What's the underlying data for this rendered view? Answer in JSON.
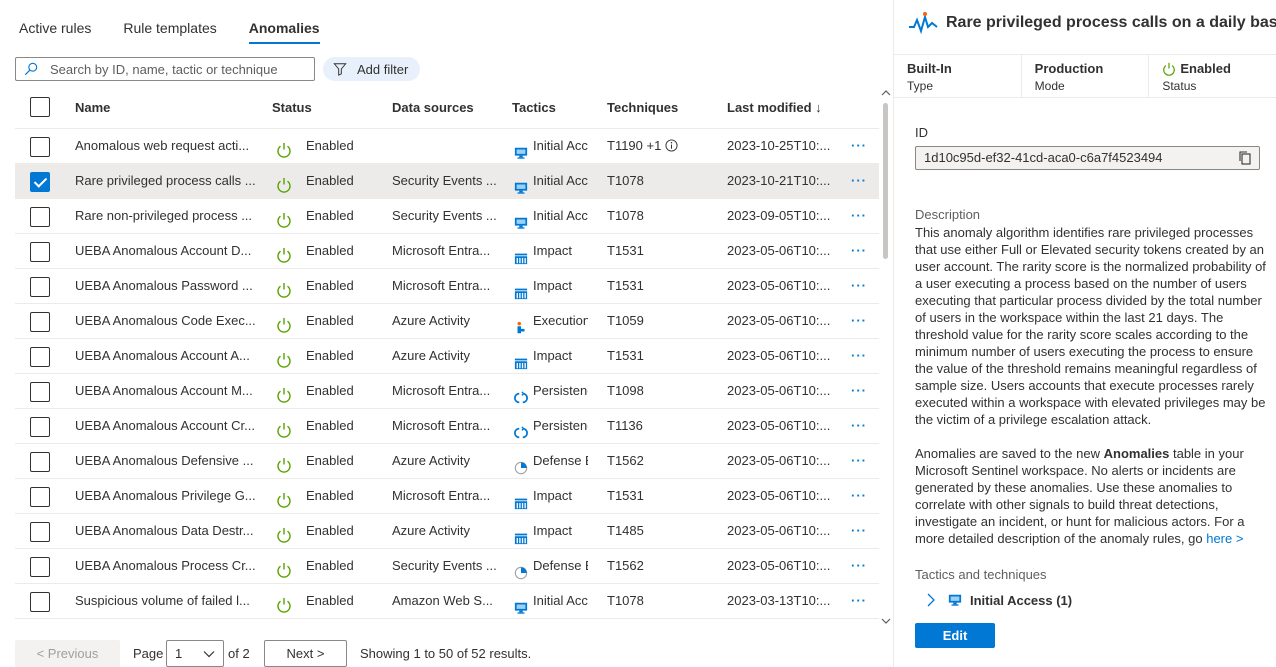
{
  "tabs": [
    {
      "label": "Active rules"
    },
    {
      "label": "Rule templates"
    },
    {
      "label": "Anomalies"
    }
  ],
  "search": {
    "placeholder": "Search by ID, name, tactic or technique"
  },
  "filter": {
    "label": "Add filter"
  },
  "table": {
    "headers": {
      "name": "Name",
      "status": "Status",
      "sources": "Data sources",
      "tactics": "Tactics",
      "techniques": "Techniques",
      "modified": "Last modified ↓"
    },
    "rows": [
      {
        "name": "Anomalous web request acti...",
        "status": "Enabled",
        "source": "",
        "tactic": "Initial Acce",
        "tactic_icon": "monitor-icon",
        "technique": "T1190 +1",
        "modified": "2023-10-25T10:...",
        "more": "···",
        "checked": false
      },
      {
        "name": "Rare privileged process calls ...",
        "status": "Enabled",
        "source": "Security Events ...",
        "tactic": "Initial Acc",
        "tactic_icon": "monitor-icon",
        "technique": "T1078",
        "modified": "2023-10-21T10:...",
        "more": "···",
        "checked": true
      },
      {
        "name": "Rare non-privileged process ...",
        "status": "Enabled",
        "source": "Security Events ...",
        "tactic": "Initial Acc",
        "tactic_icon": "monitor-icon",
        "technique": "T1078",
        "modified": "2023-09-05T10:...",
        "more": "···",
        "checked": false
      },
      {
        "name": "UEBA Anomalous Account D...",
        "status": "Enabled",
        "source": "Microsoft Entra...",
        "tactic": "Impact",
        "tactic_icon": "impact-icon",
        "technique": "T1531",
        "modified": "2023-05-06T10:...",
        "more": "···",
        "checked": false
      },
      {
        "name": "UEBA Anomalous Password ...",
        "status": "Enabled",
        "source": "Microsoft Entra...",
        "tactic": "Impact",
        "tactic_icon": "impact-icon",
        "technique": "T1531",
        "modified": "2023-05-06T10:...",
        "more": "···",
        "checked": false
      },
      {
        "name": "UEBA Anomalous Code Exec...",
        "status": "Enabled",
        "source": "Azure Activity",
        "tactic": "Execution",
        "tactic_icon": "execution-icon",
        "technique": "T1059",
        "modified": "2023-05-06T10:...",
        "more": "···",
        "checked": false
      },
      {
        "name": "UEBA Anomalous Account A...",
        "status": "Enabled",
        "source": "Azure Activity",
        "tactic": "Impact",
        "tactic_icon": "impact-icon",
        "technique": "T1531",
        "modified": "2023-05-06T10:...",
        "more": "···",
        "checked": false
      },
      {
        "name": "UEBA Anomalous Account M...",
        "status": "Enabled",
        "source": "Microsoft Entra...",
        "tactic": "Persistenc",
        "tactic_icon": "persistence-icon",
        "technique": "T1098",
        "modified": "2023-05-06T10:...",
        "more": "···",
        "checked": false
      },
      {
        "name": "UEBA Anomalous Account Cr...",
        "status": "Enabled",
        "source": "Microsoft Entra...",
        "tactic": "Persistenc",
        "tactic_icon": "persistence-icon",
        "technique": "T1136",
        "modified": "2023-05-06T10:...",
        "more": "···",
        "checked": false
      },
      {
        "name": "UEBA Anomalous Defensive ...",
        "status": "Enabled",
        "source": "Azure Activity",
        "tactic": "Defense E",
        "tactic_icon": "defense-icon",
        "technique": "T1562",
        "modified": "2023-05-06T10:...",
        "more": "···",
        "checked": false
      },
      {
        "name": "UEBA Anomalous Privilege G...",
        "status": "Enabled",
        "source": "Microsoft Entra...",
        "tactic": "Impact",
        "tactic_icon": "impact-icon",
        "technique": "T1531",
        "modified": "2023-05-06T10:...",
        "more": "···",
        "checked": false
      },
      {
        "name": "UEBA Anomalous Data Destr...",
        "status": "Enabled",
        "source": "Azure Activity",
        "tactic": "Impact",
        "tactic_icon": "impact-icon",
        "technique": "T1485",
        "modified": "2023-05-06T10:...",
        "more": "···",
        "checked": false
      },
      {
        "name": "UEBA Anomalous Process Cr...",
        "status": "Enabled",
        "source": "Security Events ...",
        "tactic": "Defense E",
        "tactic_icon": "defense-icon",
        "technique": "T1562",
        "modified": "2023-05-06T10:...",
        "more": "···",
        "checked": false
      },
      {
        "name": "Suspicious volume of failed l...",
        "status": "Enabled",
        "source": "Amazon Web S...",
        "tactic": "Initial Acc",
        "tactic_icon": "monitor-icon",
        "technique": "T1078",
        "modified": "2023-03-13T10:...",
        "more": "···",
        "checked": false
      }
    ]
  },
  "pager": {
    "previous": "< Previous",
    "page_label": "Page",
    "page_value": "1",
    "of_label": "of 2",
    "next": "Next >",
    "showing": "Showing 1 to 50 of 52 results."
  },
  "details": {
    "title": "Rare privileged process calls on a daily basis",
    "props": [
      {
        "value": "Built-In",
        "label": "Type"
      },
      {
        "value": "Production",
        "label": "Mode"
      },
      {
        "value": "Enabled",
        "label": "Status"
      }
    ],
    "id_label": "ID",
    "id_value": "1d10c95d-ef32-41cd-aca0-c6a7f4523494",
    "description_label": "Description",
    "description": "This anomaly algorithm identifies rare privileged processes that use either Full or Elevated security tokens created by an user account. The rarity score is the normalized probability of a user executing a process based on the number of users executing that particular process divided by the total number of users in the workspace within the last 21 days. The threshold value for the rarity score scales according to the minimum number of users executing the process to ensure the value of the threshold remains meaningful regardless of sample size. Users accounts that execute processes rarely executed within a workspace with elevated privileges may be the victim of a privilege escalation attack.",
    "desc2_a": "Anomalies are saved to the new ",
    "desc2_bold": "Anomalies",
    "desc2_b": " table in your Microsoft Sentinel workspace. No alerts or incidents are generated by these anomalies. Use these anomalies to correlate with other signals to build threat detections, investigate an incident, or hunt for malicious actors. For a more detailed description of the anomaly rules, go ",
    "desc2_link": "here >",
    "tactics_label": "Tactics and techniques",
    "tactic_item": "Initial Access (1)",
    "edit": "Edit"
  },
  "colors": {
    "accent": "#0078d4",
    "enabled": "#57a300"
  }
}
